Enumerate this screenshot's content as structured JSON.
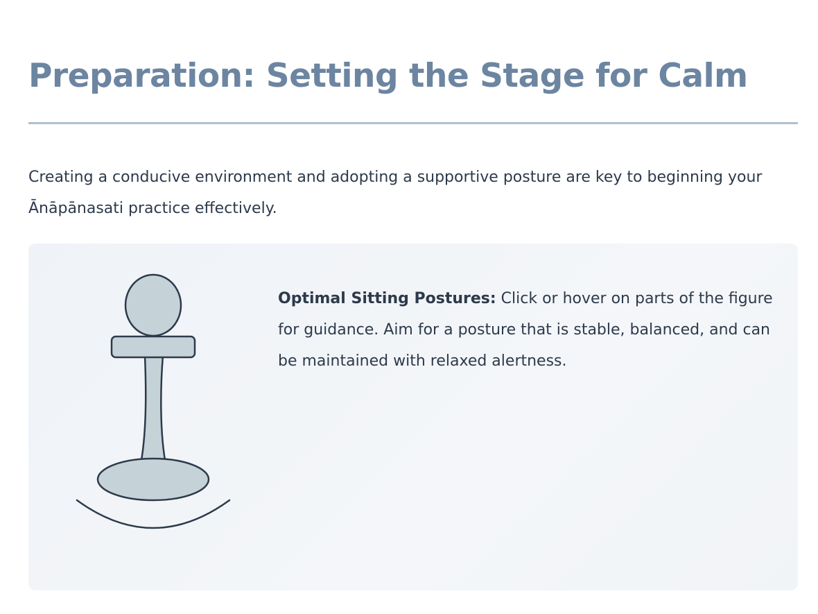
{
  "header": {
    "title": "Preparation: Setting the Stage for Calm"
  },
  "intro": {
    "text": "Creating a conducive environment and adopting a supportive posture are key to beginning your Ānāpānasati practice effectively."
  },
  "posture_panel": {
    "heading": "Optimal Sitting Postures:",
    "description": " Click or hover on parts of the figure for guidance. Aim for a posture that is stable, balanced, and can be maintained with relaxed alertness."
  },
  "colors": {
    "title": "#6c85a1",
    "rule": "#aec0cd",
    "body_text": "#2d3a4b",
    "panel_bg": "#f1f4f7",
    "figure_fill": "#c5d3d9",
    "figure_stroke": "#2d3a4b"
  }
}
